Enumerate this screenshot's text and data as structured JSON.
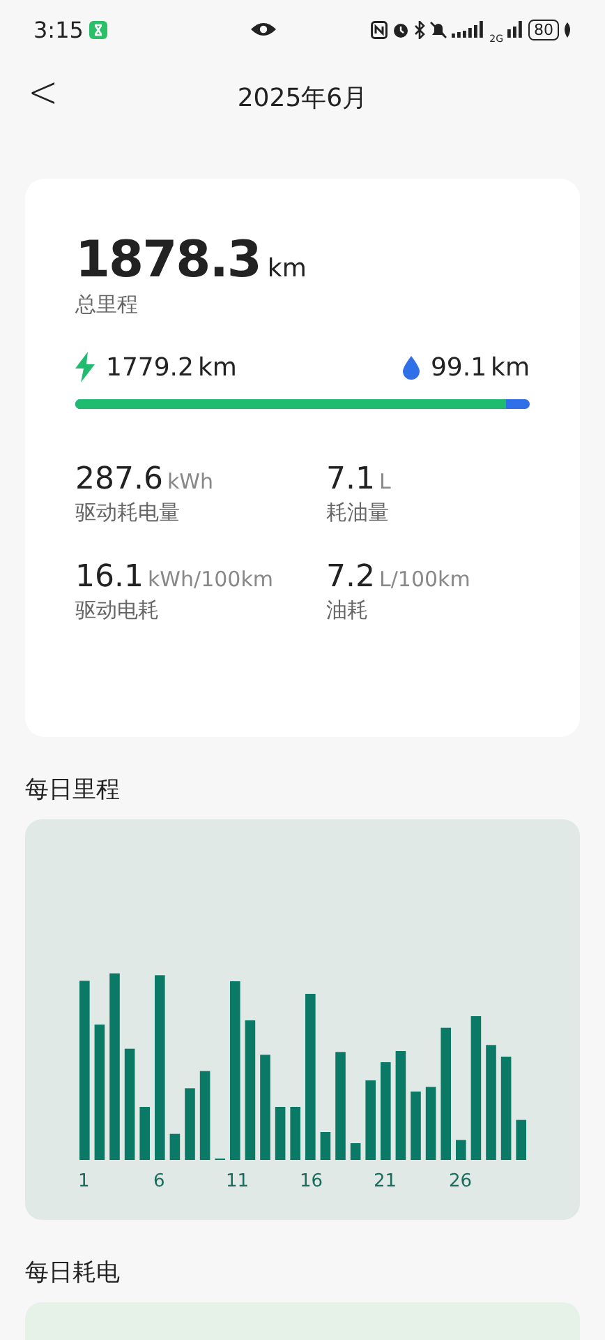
{
  "status_bar": {
    "time": "3:15",
    "network_label": "2G",
    "battery": "80"
  },
  "header": {
    "back": "<",
    "title": "2025年6月"
  },
  "summary": {
    "total": "1878.3",
    "total_unit": "km",
    "total_label": "总里程",
    "electric": "1779.2",
    "electric_unit": "km",
    "fuel": "99.1",
    "fuel_unit": "km",
    "level": 0.947,
    "stats": [
      {
        "value": "287.6",
        "unit": "kWh",
        "label": "驱动耗电量"
      },
      {
        "value": "7.1",
        "unit": "L",
        "label": "耗油量"
      },
      {
        "value": "16.1",
        "unit": "kWh/100km",
        "label": "驱动电耗"
      },
      {
        "value": "7.2",
        "unit": "L/100km",
        "label": "油耗"
      }
    ]
  },
  "daily_mileage": {
    "title": "每日里程",
    "x_labels": [
      "1",
      "6",
      "11",
      "16",
      "21",
      "26"
    ]
  },
  "daily_energy": {
    "title": "每日耗电"
  }
}
